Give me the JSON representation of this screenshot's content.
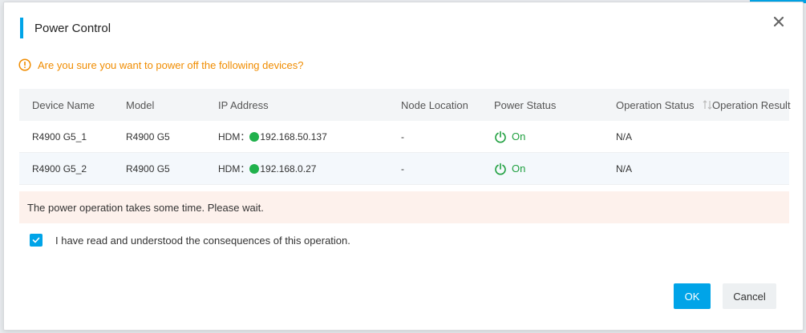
{
  "dialog": {
    "title": "Power Control",
    "warning": "Are you sure you want to power off the following devices?",
    "notice": "The power operation takes some time. Please wait.",
    "agree_label": "I have read and understood the consequences of this operation.",
    "agree_checked": true,
    "ok_label": "OK",
    "cancel_label": "Cancel"
  },
  "table": {
    "headers": {
      "device": "Device Name",
      "model": "Model",
      "ip": "IP Address",
      "node": "Node Location",
      "power": "Power Status",
      "opstatus": "Operation Status",
      "result": "Operation Result"
    },
    "rows": [
      {
        "device": "R4900 G5_1",
        "model": "R4900 G5",
        "ip_prefix": "HDM：",
        "ip": "192.168.50.137",
        "node": "-",
        "power": "On",
        "opstatus": "N/A"
      },
      {
        "device": "R4900 G5_2",
        "model": "R4900 G5",
        "ip_prefix": "HDM：",
        "ip": "192.168.0.27",
        "node": "-",
        "power": "On",
        "opstatus": "N/A"
      }
    ]
  },
  "colors": {
    "accent": "#00a4e8",
    "warning": "#f08c00",
    "status_on": "#20a040",
    "notice_bg": "#fdf1ec"
  },
  "icons": {
    "close": "close-icon",
    "warning": "warning-circle-icon",
    "power": "power-icon",
    "sort": "sort-icon",
    "check": "check-icon",
    "ip_status": "status-dot-icon"
  }
}
